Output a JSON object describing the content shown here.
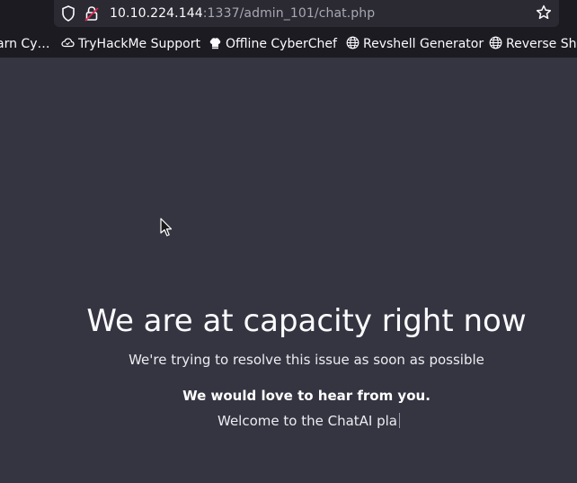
{
  "browser": {
    "url_host": "10.10.224.144",
    "url_path": ":1337/admin_101/chat.php",
    "bookmarks": [
      {
        "label": "arn Cy…",
        "icon": "folder-icon"
      },
      {
        "label": "TryHackMe Support",
        "icon": "cloud-icon"
      },
      {
        "label": "Offline CyberChef",
        "icon": "chef-hat-icon"
      },
      {
        "label": "Revshell Generator",
        "icon": "globe-icon"
      },
      {
        "label": "Reverse She",
        "icon": "globe-icon"
      }
    ]
  },
  "page": {
    "headline": "We are at capacity right now",
    "subline": "We're trying to resolve this issue as soon as possible",
    "love_line": "We would love to hear from you.",
    "typing_text": "Welcome to the ChatAI pla"
  },
  "colors": {
    "background": "#343541",
    "chrome": "#1c1b22",
    "urlbar": "#2b2a33"
  }
}
